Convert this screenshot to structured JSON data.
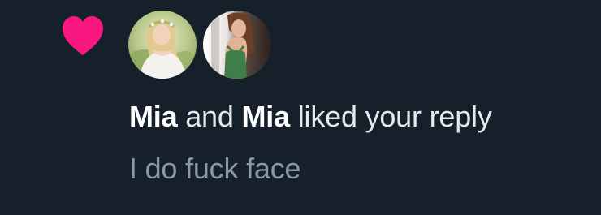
{
  "notification": {
    "type_icon": "heart-icon",
    "icon_color": "#f91880",
    "users": [
      {
        "name": "Mia",
        "avatar": "avatar-photo-outdoor"
      },
      {
        "name": "Mia",
        "avatar": "avatar-photo-green-dress"
      }
    ],
    "connector": " and ",
    "action_text": " liked your reply",
    "reply_text": "I do fuck face"
  },
  "colors": {
    "background": "#15202b",
    "primary_text": "#e7e9ea",
    "secondary_text": "#8b98a5",
    "like_pink": "#f91880"
  }
}
